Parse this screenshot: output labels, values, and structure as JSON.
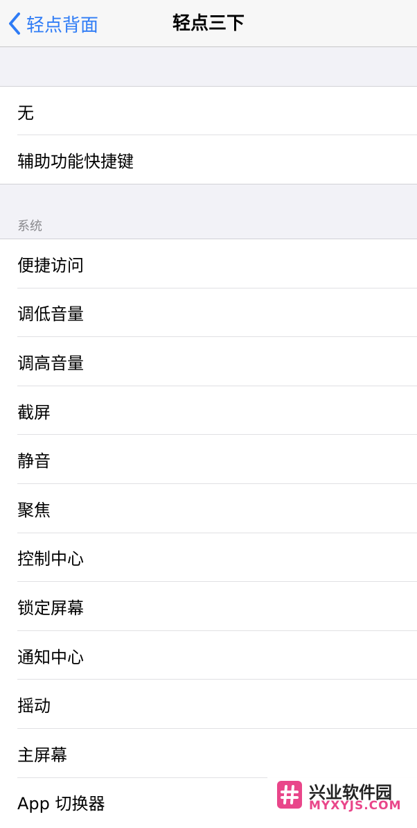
{
  "nav": {
    "back_label": "轻点背面",
    "title": "轻点三下"
  },
  "group1": {
    "items": [
      {
        "label": "无"
      },
      {
        "label": "辅助功能快捷键"
      }
    ]
  },
  "system": {
    "header": "系统",
    "items": [
      {
        "label": "便捷访问"
      },
      {
        "label": "调低音量"
      },
      {
        "label": "调高音量"
      },
      {
        "label": "截屏"
      },
      {
        "label": "静音"
      },
      {
        "label": "聚焦"
      },
      {
        "label": "控制中心"
      },
      {
        "label": "锁定屏幕"
      },
      {
        "label": "通知中心"
      },
      {
        "label": "摇动"
      },
      {
        "label": "主屏幕"
      },
      {
        "label": "App 切换器"
      }
    ]
  },
  "watermark": {
    "name": "兴业软件园",
    "url": "MYXYJS.COM"
  },
  "colors": {
    "accent": "#2f7cf6",
    "background": "#f2f2f7",
    "watermark": "#e9468a"
  }
}
